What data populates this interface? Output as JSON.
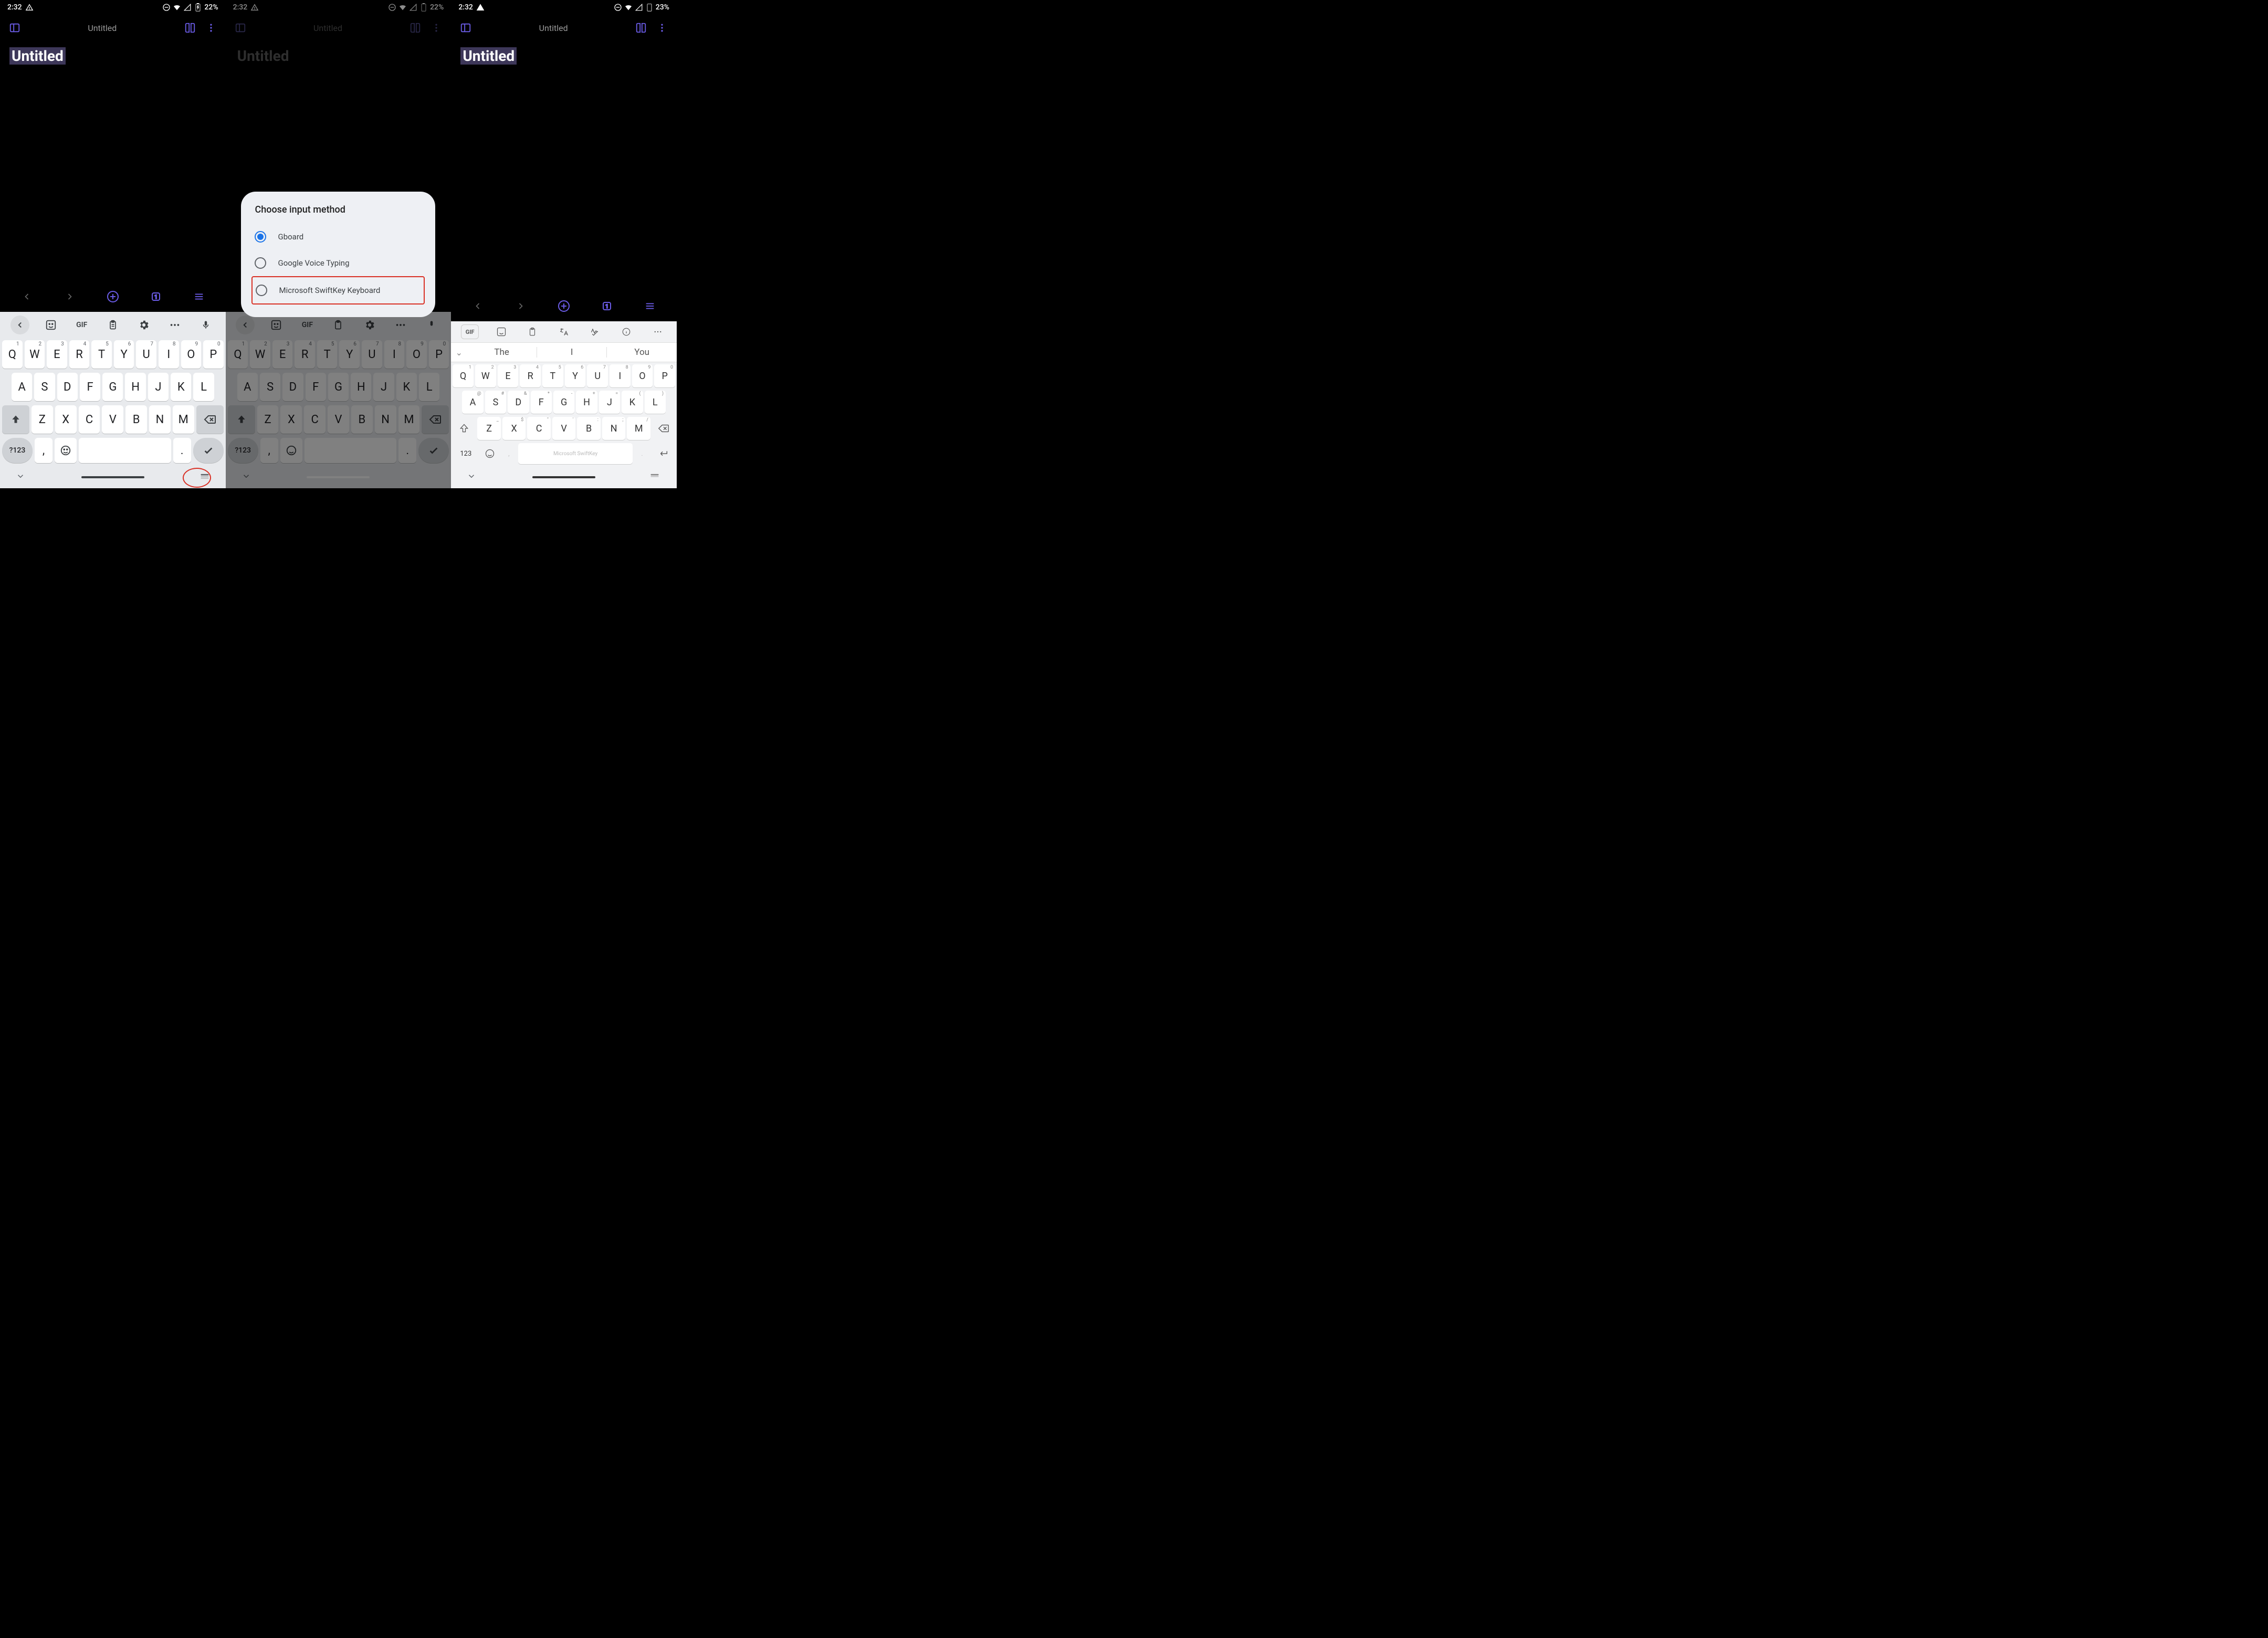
{
  "screens": [
    {
      "time": "2:32",
      "battery": "22%",
      "title": "Untitled",
      "doc": "Untitled"
    },
    {
      "time": "2:32",
      "battery": "22%",
      "title": "Untitled",
      "doc": "Untitled"
    },
    {
      "time": "2:32",
      "battery": "23%",
      "title": "Untitled",
      "doc": "Untitled"
    }
  ],
  "modal": {
    "title": "Choose input method",
    "options": [
      "Gboard",
      "Google Voice Typing",
      "Microsoft SwiftKey Keyboard"
    ],
    "selected": 0,
    "highlighted": 2
  },
  "gboard": {
    "gif": "GIF",
    "row1": [
      [
        "Q",
        "1"
      ],
      [
        "W",
        "2"
      ],
      [
        "E",
        "3"
      ],
      [
        "R",
        "4"
      ],
      [
        "T",
        "5"
      ],
      [
        "Y",
        "6"
      ],
      [
        "U",
        "7"
      ],
      [
        "I",
        "8"
      ],
      [
        "O",
        "9"
      ],
      [
        "P",
        "0"
      ]
    ],
    "row2": [
      "A",
      "S",
      "D",
      "F",
      "G",
      "H",
      "J",
      "K",
      "L"
    ],
    "row3": [
      "Z",
      "X",
      "C",
      "V",
      "B",
      "N",
      "M"
    ],
    "nums": "?123",
    "comma": ",",
    "dot": "."
  },
  "swiftkey": {
    "gif": "GIF",
    "suggestions": [
      "The",
      "I",
      "You"
    ],
    "row1": [
      [
        "Q",
        "1"
      ],
      [
        "W",
        "2"
      ],
      [
        "E",
        "3"
      ],
      [
        "R",
        "4"
      ],
      [
        "T",
        "5"
      ],
      [
        "Y",
        "6"
      ],
      [
        "U",
        "7"
      ],
      [
        "I",
        "8"
      ],
      [
        "O",
        "9"
      ],
      [
        "P",
        "0"
      ]
    ],
    "row2": [
      [
        "A",
        "@"
      ],
      [
        "S",
        "#"
      ],
      [
        "D",
        "&"
      ],
      [
        "F",
        "*"
      ],
      [
        "G",
        "-"
      ],
      [
        "H",
        "+"
      ],
      [
        "J",
        "="
      ],
      [
        "K",
        "("
      ],
      [
        "L",
        ")"
      ]
    ],
    "row3": [
      [
        "Z",
        "_"
      ],
      [
        "X",
        "$"
      ],
      [
        "C",
        "\""
      ],
      [
        "V",
        "'"
      ],
      [
        "B",
        ":"
      ],
      [
        "N",
        ";"
      ],
      [
        "M",
        "/"
      ]
    ],
    "nums": "123",
    "space": "Microsoft SwiftKey",
    "comma": ",",
    "dot": "."
  },
  "bottom_bar_page": "1"
}
